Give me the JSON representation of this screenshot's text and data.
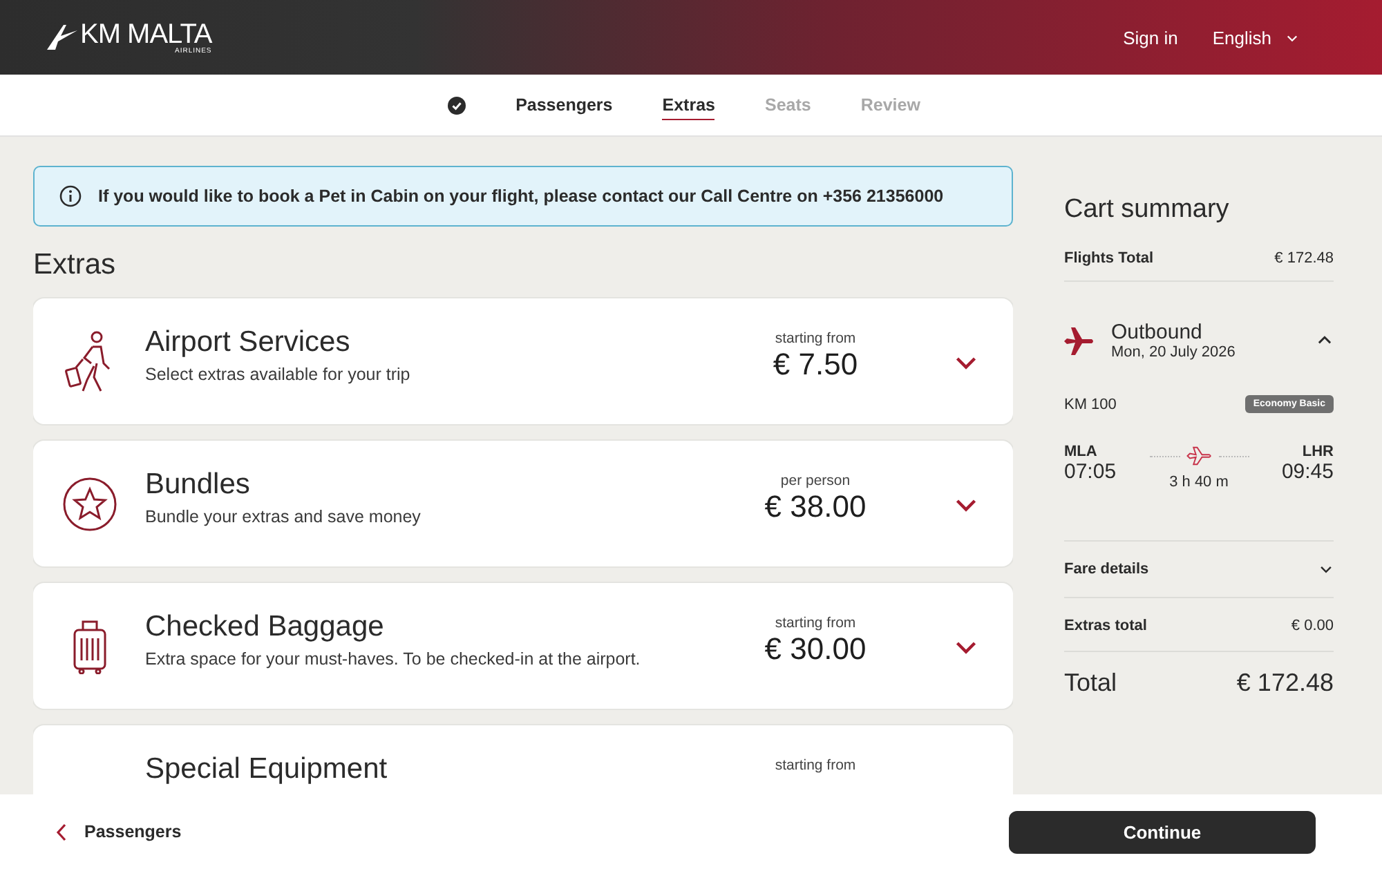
{
  "header": {
    "logo": "**KM** MALTA",
    "logo_subtitle": "AIRLINES",
    "sign_in": "Sign in",
    "language": "English"
  },
  "steps": [
    {
      "label": "Passengers",
      "completed": true,
      "selected": false
    },
    {
      "label": "Extras",
      "completed": false,
      "selected": true
    },
    {
      "label": "Seats",
      "completed": false,
      "selected": false
    },
    {
      "label": "Review",
      "completed": false,
      "selected": false
    }
  ],
  "notice": "If you would like to book a Pet in Cabin on your flight, please contact our Call Centre on +356 21356000",
  "extras": {
    "title": "Extras",
    "items": [
      {
        "kind": "services",
        "title": "Airport Services",
        "description": "Select extras available for your trip",
        "price_label": "starting from",
        "price": "€ 7.50",
        "expanded": false
      },
      {
        "kind": "bundles",
        "title": "Bundles",
        "description": "Bundle your extras and save money",
        "price_label": "per person",
        "price": "€ 38.00",
        "expanded": false
      },
      {
        "kind": "baggage",
        "title": "Checked Baggage",
        "description": "Extra space for your must-haves. To be checked-in at the airport.",
        "price_label": "starting from",
        "price": "€ 30.00",
        "expanded": false
      },
      {
        "kind": "equipment",
        "title": "Special Equipment",
        "price_label": "starting from"
      }
    ]
  },
  "cart": {
    "title": "Cart summary",
    "flights_total": {
      "label": "Flights Total",
      "value": "€ 172.48"
    },
    "outbound": {
      "title": "Outbound",
      "date": "Mon, 20 July 2026",
      "expanded": true,
      "flight_number": "KM 100",
      "fare": "Economy Basic",
      "origin": {
        "code": "MLA",
        "time": "07:05"
      },
      "destination": {
        "code": "LHR",
        "time": "09:45"
      },
      "duration": "3 h 40 m"
    },
    "fare_details": {
      "label": "Fare details",
      "expanded": false
    },
    "extras_total": {
      "label": "Extras total",
      "value": "€ 0.00"
    },
    "total": {
      "label": "Total",
      "value": "€ 172.48"
    }
  },
  "footer": {
    "back": "Passengers",
    "continue": "Continue"
  }
}
